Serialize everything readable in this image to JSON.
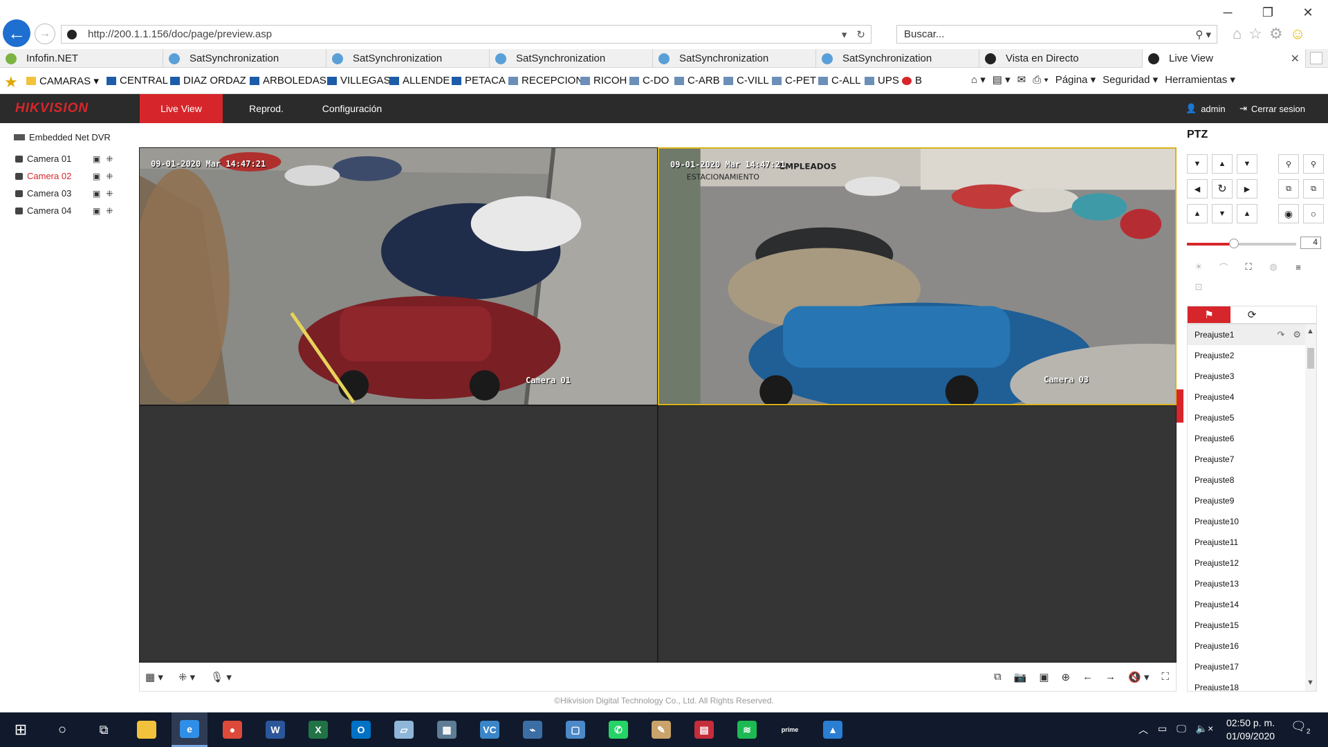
{
  "browser": {
    "address_url": "http://200.1.1.156/doc/page/preview.asp",
    "search_placeholder": "Buscar...",
    "tabs": [
      {
        "label": "Infofin.NET",
        "color": "#7cb342"
      },
      {
        "label": "SatSynchronization",
        "color": "#5aa0d8"
      },
      {
        "label": "SatSynchronization",
        "color": "#5aa0d8"
      },
      {
        "label": "SatSynchronization",
        "color": "#5aa0d8"
      },
      {
        "label": "SatSynchronization",
        "color": "#5aa0d8"
      },
      {
        "label": "SatSynchronization",
        "color": "#5aa0d8"
      },
      {
        "label": "Vista en Directo",
        "color": "#222222"
      },
      {
        "label": "Live View",
        "color": "#222222"
      }
    ],
    "favorites": [
      "CAMARAS",
      "CENTRAL",
      "DIAZ ORDAZ",
      "ARBOLEDAS",
      "VILLEGAS",
      "ALLENDE",
      "PETACA",
      "RECEPCION",
      "RICOH",
      "C-DO",
      "C-ARB",
      "C-VILL",
      "C-PET",
      "C-ALL",
      "UPS",
      "B"
    ],
    "command_menu": {
      "page": "Página",
      "safety": "Seguridad",
      "tools": "Herramientas"
    }
  },
  "app": {
    "brand": "HIKVISION",
    "nav": {
      "live": "Live View",
      "playback": "Reprod.",
      "config": "Configuración"
    },
    "user": "admin",
    "logout": "Cerrar sesion"
  },
  "tree": {
    "device": "Embedded Net DVR",
    "cameras": [
      {
        "name": "Camera 01",
        "active": false
      },
      {
        "name": "Camera 02",
        "active": true
      },
      {
        "name": "Camera 03",
        "active": false
      },
      {
        "name": "Camera 04",
        "active": false
      }
    ]
  },
  "video": {
    "cell1": {
      "timestamp": "09-01-2020 Mar 14:47:21",
      "label": "Camera 01"
    },
    "cell2": {
      "timestamp": "09-01-2020 Mar 14:47:21",
      "label": "Camera 03",
      "sign1": "ESTACIONAMIENTO",
      "sign2": "EMPLEADOS"
    }
  },
  "copyright": "©Hikvision Digital Technology Co., Ltd. All Rights Reserved.",
  "ptz": {
    "title": "PTZ",
    "speed": "4",
    "speed_level": 0.43,
    "presets": [
      "Preajuste1",
      "Preajuste2",
      "Preajuste3",
      "Preajuste4",
      "Preajuste5",
      "Preajuste6",
      "Preajuste7",
      "Preajuste8",
      "Preajuste9",
      "Preajuste10",
      "Preajuste11",
      "Preajuste12",
      "Preajuste13",
      "Preajuste14",
      "Preajuste15",
      "Preajuste16",
      "Preajuste17",
      "Preajuste18"
    ]
  },
  "taskbar": {
    "clock_time": "02:50 p. m.",
    "clock_date": "01/09/2020",
    "notifications": "2",
    "apps": [
      {
        "name": "file-explorer",
        "color": "#f3c23c",
        "glyph": ""
      },
      {
        "name": "internet-explorer",
        "color": "#2f8ee8",
        "glyph": "e"
      },
      {
        "name": "chrome",
        "color": "#de4a3a",
        "glyph": "●"
      },
      {
        "name": "word",
        "color": "#2b579a",
        "glyph": "W"
      },
      {
        "name": "excel",
        "color": "#217346",
        "glyph": "X"
      },
      {
        "name": "outlook",
        "color": "#0072c6",
        "glyph": "O"
      },
      {
        "name": "notes",
        "color": "#8fb6d8",
        "glyph": "▱"
      },
      {
        "name": "calculator",
        "color": "#5f7d95",
        "glyph": "▦"
      },
      {
        "name": "vs-code",
        "color": "#3a86c8",
        "glyph": "VC"
      },
      {
        "name": "remote",
        "color": "#3a6ea5",
        "glyph": "⌁"
      },
      {
        "name": "vm-client",
        "color": "#4b89c9",
        "glyph": "▢"
      },
      {
        "name": "whatsapp",
        "color": "#25d366",
        "glyph": "✆"
      },
      {
        "name": "paint",
        "color": "#c9a36a",
        "glyph": "✎"
      },
      {
        "name": "clipboard",
        "color": "#c62d3b",
        "glyph": "▤"
      },
      {
        "name": "spotify",
        "color": "#1db954",
        "glyph": "≋"
      },
      {
        "name": "prime-video",
        "color": "#101a2c",
        "glyph": "prime"
      },
      {
        "name": "photos",
        "color": "#2a7ed3",
        "glyph": "▲"
      }
    ]
  }
}
